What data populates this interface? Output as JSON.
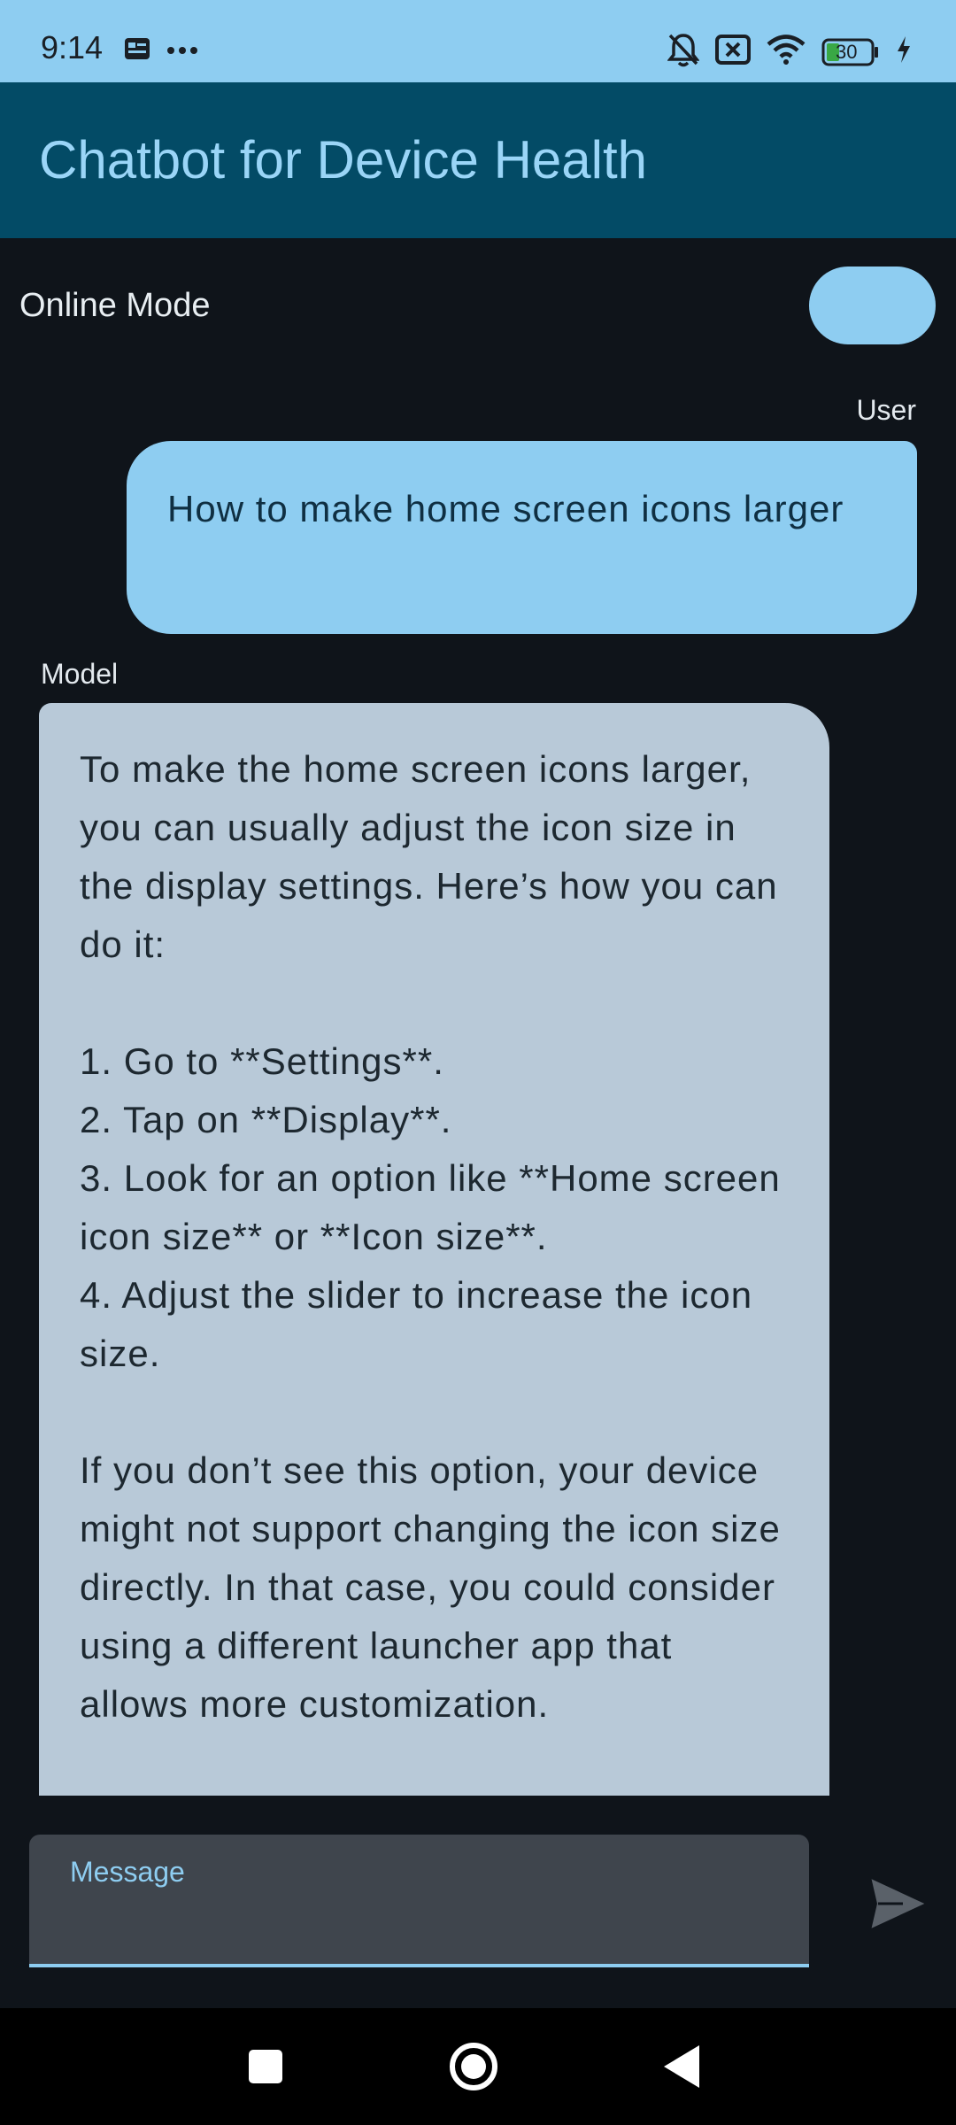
{
  "status_bar": {
    "time": "9:14",
    "battery": "30",
    "icons": [
      "notification-card-icon",
      "more-dots-icon",
      "bell-off-icon",
      "no-sim-icon",
      "wifi-icon",
      "battery-icon",
      "charging-icon"
    ]
  },
  "app_bar": {
    "title": "Chatbot for Device Health"
  },
  "mode": {
    "label": "Online Mode",
    "toggle_on": true
  },
  "chat": {
    "messages": [
      {
        "sender": "User",
        "text": "How to make home screen icons larger"
      },
      {
        "sender": "Model",
        "text": "To make the home screen icons larger, you can usually adjust the icon size in the display settings. Here’s how you can do it:\n\n1. Go to **Settings**.\n2. Tap on **Display**.\n3. Look for an option like **Home screen icon size** or **Icon size**.\n4. Adjust the slider to increase the icon size.\n\nIf you don’t see this option, your device might not support changing the icon size directly. In that case, you could consider using a different launcher app that allows more customization."
      }
    ]
  },
  "input": {
    "label": "Message",
    "value": "",
    "send_icon": "send-icon"
  },
  "nav_bar": {
    "buttons": [
      "recents-square-icon",
      "home-circle-icon",
      "back-triangle-icon"
    ]
  },
  "colors": {
    "status_bar_bg": "#8ecdf1",
    "app_bar_bg": "#034b66",
    "title_color": "#9ad5f7",
    "background": "#0f141a",
    "user_bubble": "#8ecdf1",
    "model_bubble": "#b8c9d8",
    "input_bg": "#3f454d"
  }
}
